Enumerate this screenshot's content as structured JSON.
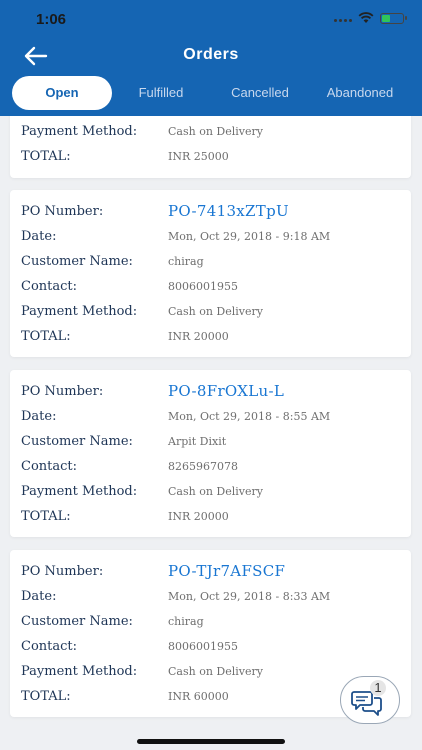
{
  "status_bar": {
    "time": "1:06"
  },
  "header": {
    "title": "Orders"
  },
  "tabs": [
    {
      "label": "Open",
      "active": true
    },
    {
      "label": "Fulfilled",
      "active": false
    },
    {
      "label": "Cancelled",
      "active": false
    },
    {
      "label": "Abandoned",
      "active": false
    }
  ],
  "labels": {
    "po_number": "PO Number:",
    "date": "Date:",
    "customer_name": "Customer Name:",
    "contact": "Contact:",
    "payment_method": "Payment Method:",
    "total": "TOTAL:"
  },
  "partial_order": {
    "payment_method": "Cash on Delivery",
    "total": "INR 25000"
  },
  "orders": [
    {
      "po_number": "PO-7413xZTpU",
      "date": "Mon, Oct 29, 2018 - 9:18 AM",
      "customer_name": "chirag",
      "contact": "8006001955",
      "payment_method": "Cash on Delivery",
      "total": "INR 20000"
    },
    {
      "po_number": "PO-8FrOXLu-L",
      "date": "Mon, Oct 29, 2018 - 8:55 AM",
      "customer_name": "Arpit Dixit",
      "contact": "8265967078",
      "payment_method": "Cash on Delivery",
      "total": "INR 20000"
    },
    {
      "po_number": "PO-TJr7AFSCF",
      "date": "Mon, Oct 29, 2018 - 8:33 AM",
      "customer_name": "chirag",
      "contact": "8006001955",
      "payment_method": "Cash on Delivery",
      "total": "INR 60000"
    }
  ],
  "chat": {
    "badge_count": "1",
    "icon": "chat-bubbles-icon"
  },
  "colors": {
    "header": "#1565b3",
    "accent": "#1976d2",
    "label": "#1e3556"
  }
}
